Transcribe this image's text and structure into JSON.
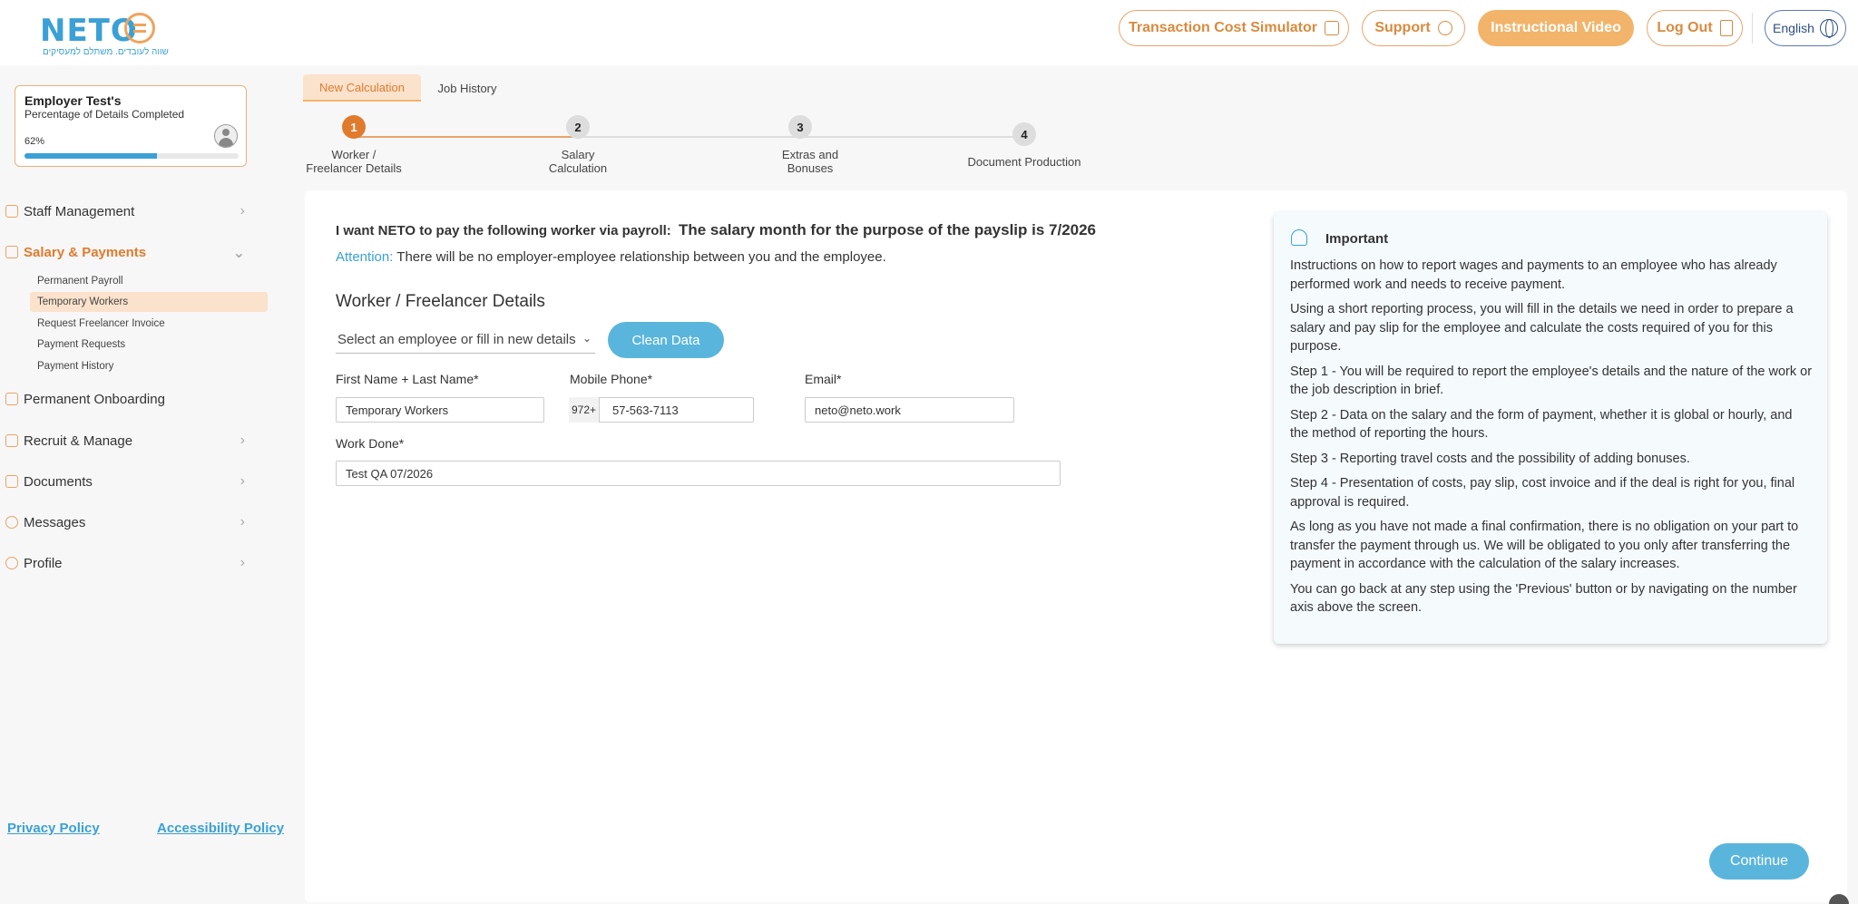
{
  "header": {
    "logo_text": "NETO",
    "logo_tagline": "שווה לעובדים. משתלם למעסיקים",
    "buttons": {
      "simulator": "Transaction Cost Simulator",
      "support": "Support",
      "video": "Instructional Video",
      "logout": "Log Out",
      "language": "English"
    }
  },
  "profile": {
    "name": "Employer Test's",
    "subtitle": "Percentage of Details Completed",
    "percent_label": "62%",
    "percent": 62
  },
  "sidebar": {
    "staff": "Staff Management",
    "salary": "Salary & Payments",
    "sub": [
      "Permanent Payroll",
      "Temporary Workers",
      "Request Freelancer Invoice",
      "Payment Requests",
      "Payment History"
    ],
    "onboarding": "Permanent Onboarding",
    "recruit": "Recruit & Manage",
    "documents": "Documents",
    "messages": "Messages",
    "profile": "Profile",
    "privacy": "Privacy Policy",
    "accessibility": "Accessibility Policy"
  },
  "tabs": {
    "new": "New Calculation",
    "history": "Job History"
  },
  "steps": [
    {
      "num": "1",
      "line1": "Worker /",
      "line2": "Freelancer Details"
    },
    {
      "num": "2",
      "line1": "Salary",
      "line2": "Calculation"
    },
    {
      "num": "3",
      "line1": "Extras and",
      "line2": "Bonuses"
    },
    {
      "num": "4",
      "line1": "Document Production",
      "line2": ""
    }
  ],
  "form": {
    "intro": "I want NETO to pay the following worker via payroll:",
    "intro_month": "The salary month for the purpose of the payslip is 7/2026",
    "attention_label": "Attention:",
    "attention_text": "There will be no employer-employee relationship between you and the employee.",
    "section_title": "Worker / Freelancer Details",
    "select_placeholder": "Select an employee or fill in new details",
    "clean": "Clean Data",
    "name_label": "First Name + Last Name*",
    "name_value": "Temporary Workers",
    "phone_label": "Mobile Phone*",
    "phone_prefix": "972+",
    "phone_value": "57-563-7113",
    "email_label": "Email*",
    "email_value": "neto@neto.work",
    "work_label": "Work Done*",
    "work_value": "Test QA 07/2026",
    "continue": "Continue"
  },
  "important": {
    "title": "Important",
    "paragraphs": [
      "Instructions on how to report wages and payments to an employee who has already performed work and needs to receive payment.",
      "Using a short reporting process, you will fill in the details we need in order to prepare a salary and pay slip for the employee and calculate the costs required of you for this purpose.",
      "Step 1 - You will be required to report the employee's details and the nature of the work or the job description in brief.",
      "Step 2 - Data on the salary and the form of payment, whether it is global or hourly, and the method of reporting the hours.",
      "Step 3 - Reporting travel costs and the possibility of adding bonuses.",
      "Step 4 - Presentation of costs, pay slip, cost invoice and if the deal is right for you, final approval is required.",
      "As long as you have not made a final confirmation, there is no obligation on your part to transfer the payment through us. We will be obligated to you only after transferring the payment in accordance with the calculation of the salary increases.",
      "You can go back at any step using the 'Previous' button or by navigating on the number axis above the screen."
    ]
  }
}
